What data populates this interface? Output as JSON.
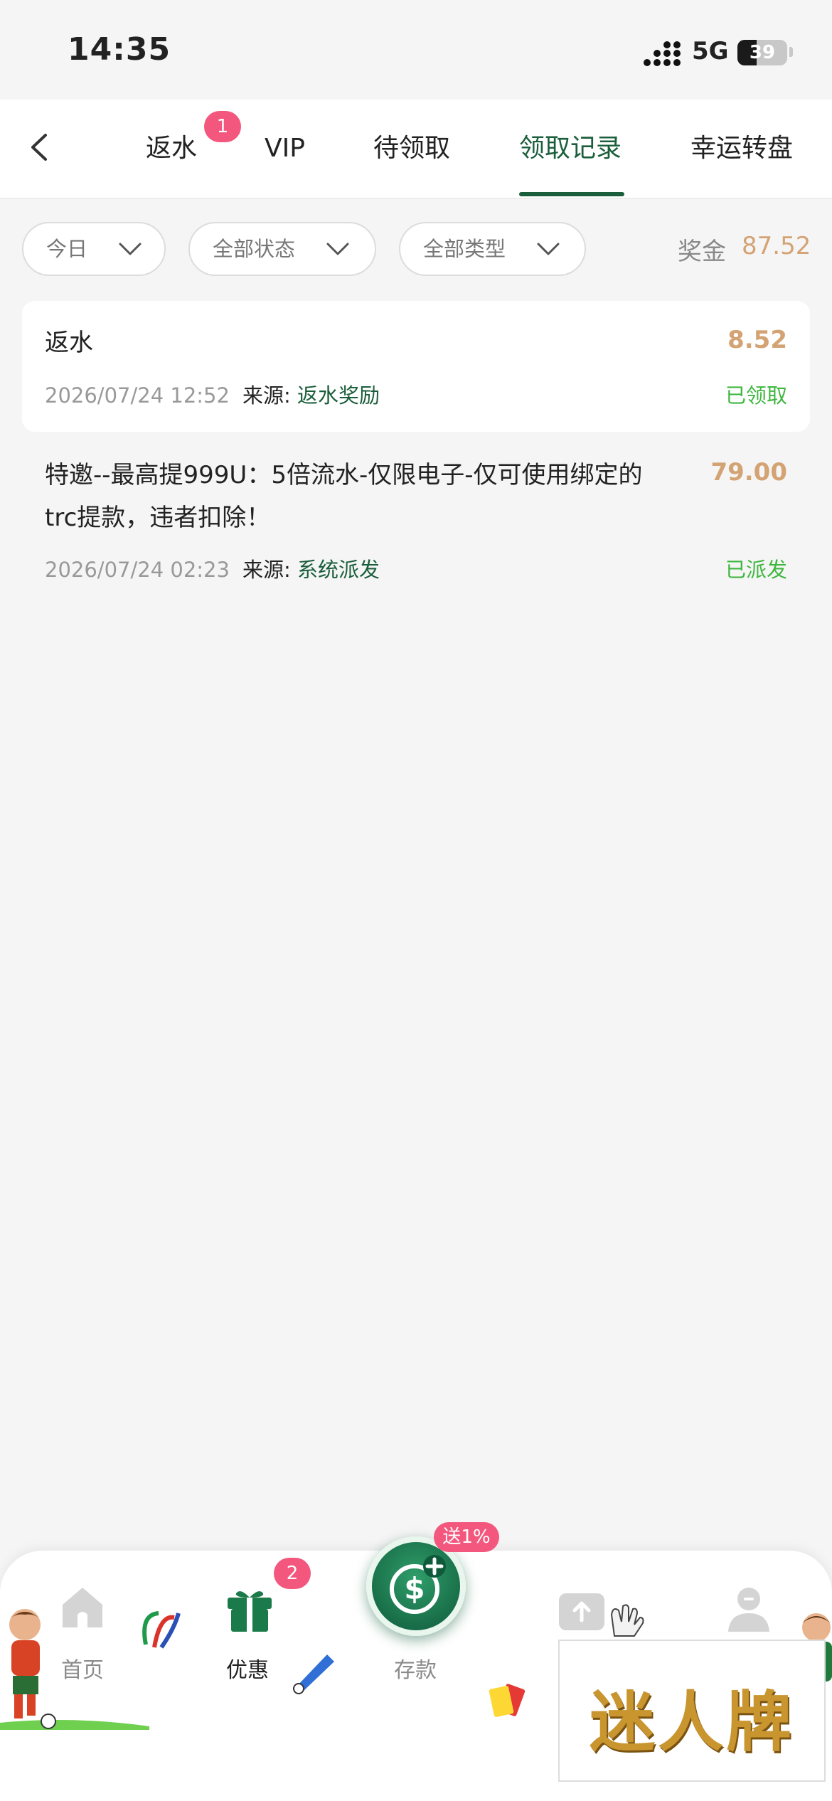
{
  "status_bar": {
    "time": "14:35",
    "network": "5G",
    "battery": "39"
  },
  "nav": {
    "tabs": [
      {
        "label": "返水",
        "badge": "1"
      },
      {
        "label": "VIP"
      },
      {
        "label": "待领取"
      },
      {
        "label": "领取记录",
        "active": true
      },
      {
        "label": "幸运转盘"
      }
    ]
  },
  "filters": {
    "date": "今日",
    "status": "全部状态",
    "type": "全部类型"
  },
  "bonus": {
    "label": "奖金",
    "value": "87.52"
  },
  "records": [
    {
      "title": "返水",
      "amount": "8.52",
      "datetime": "2026/07/24 12:52",
      "source_label": "来源:",
      "source": "返水奖励",
      "status": "已领取"
    },
    {
      "title": "特邀--最高提999U：5倍流水-仅限电子-仅可使用绑定的trc提款，违者扣除！",
      "amount": "79.00",
      "datetime": "2026/07/24 02:23",
      "source_label": "来源:",
      "source": "系统派发",
      "status": "已派发"
    }
  ],
  "bottom_nav": {
    "home": "首页",
    "promo": "优惠",
    "promo_badge": "2",
    "deposit": "存款",
    "deposit_badge": "送1%"
  },
  "ad": {
    "text": "迷人牌"
  },
  "colors": {
    "primary": "#1b5e3b",
    "gold": "#d4a374",
    "success": "#3fb73f",
    "badge": "#f3577d"
  }
}
